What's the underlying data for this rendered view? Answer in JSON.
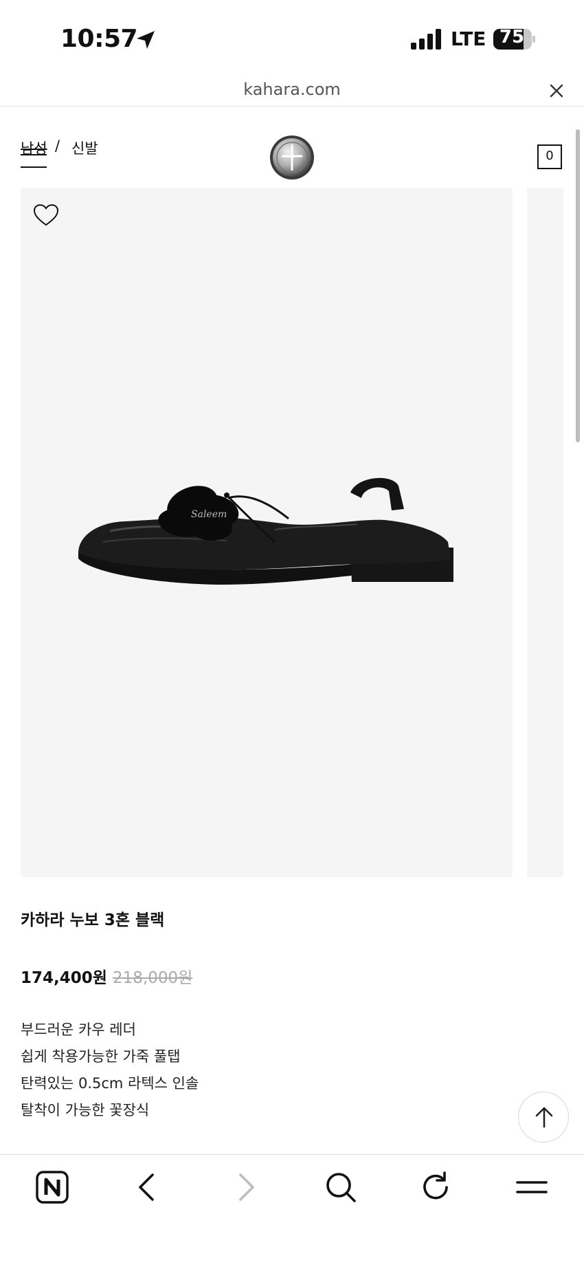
{
  "status_bar": {
    "time": "10:57",
    "network": "LTE",
    "battery": "75"
  },
  "browser": {
    "url": "kahara.com"
  },
  "header": {
    "breadcrumb": [
      "남성",
      "/",
      "신발"
    ],
    "cart_count": "0"
  },
  "product": {
    "name": "카하라 누보 3혼 블랙",
    "sale_price": "174,400원",
    "original_price": "218,000원",
    "features": [
      "부드러운 카우 레더",
      "쉽게 착용가능한 가죽 풀탭",
      "탄력있는 0.5cm 라텍스 인솔",
      "탈착이 가능한 꽃장식"
    ]
  },
  "icons": {
    "status": [
      "location-arrow-icon",
      "signal-icon",
      "battery-icon"
    ],
    "browser": [
      "close-icon"
    ],
    "header": [
      "menu-icon",
      "logo-icon",
      "cart-icon"
    ],
    "product": [
      "heart-icon",
      "arrow-up-icon"
    ],
    "toolbar": [
      "naver-home-icon",
      "back-icon",
      "forward-icon",
      "search-icon",
      "reload-icon",
      "menu-icon"
    ]
  },
  "colors": {
    "image_bg": "#f5f5f5",
    "text": "#111111",
    "muted": "#aaaaaa"
  }
}
